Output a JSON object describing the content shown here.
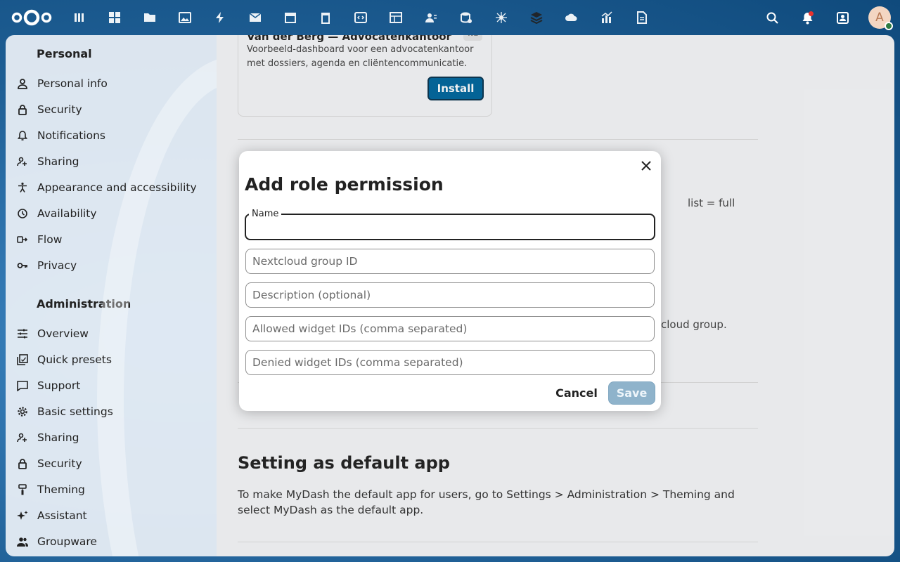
{
  "header": {
    "apps": [
      "dashboard-icon",
      "grid-icon",
      "folder-icon",
      "image-icon",
      "activity-icon",
      "mail-icon",
      "calendar-icon",
      "trash-icon",
      "code-icon",
      "table-icon",
      "contacts-icon",
      "database-icon",
      "spider-icon",
      "layers-icon",
      "cloud-icon",
      "chart-icon",
      "document-icon"
    ],
    "avatar_initial": "A"
  },
  "sidebar": {
    "personal_title": "Personal",
    "personal_items": [
      {
        "label": "Personal info",
        "icon": "user-icon"
      },
      {
        "label": "Security",
        "icon": "lock-icon"
      },
      {
        "label": "Notifications",
        "icon": "bell-icon"
      },
      {
        "label": "Sharing",
        "icon": "share-icon"
      },
      {
        "label": "Appearance and accessibility",
        "icon": "accessibility-icon"
      },
      {
        "label": "Availability",
        "icon": "clock-icon"
      },
      {
        "label": "Flow",
        "icon": "flow-icon"
      },
      {
        "label": "Privacy",
        "icon": "key-icon"
      }
    ],
    "admin_title": "Administration",
    "admin_items": [
      {
        "label": "Overview",
        "icon": "sliders-icon"
      },
      {
        "label": "Quick presets",
        "icon": "presets-icon"
      },
      {
        "label": "Support",
        "icon": "support-icon"
      },
      {
        "label": "Basic settings",
        "icon": "gear-icon"
      },
      {
        "label": "Sharing",
        "icon": "share-icon"
      },
      {
        "label": "Security",
        "icon": "lock-icon"
      },
      {
        "label": "Theming",
        "icon": "brush-icon"
      },
      {
        "label": "Assistant",
        "icon": "sparkle-icon"
      },
      {
        "label": "Groupware",
        "icon": "group-icon"
      }
    ]
  },
  "main": {
    "card": {
      "title": "Van der Berg — Advocatenkantoor",
      "badge": "NL",
      "description": "Voorbeeld-dashboard voor een advocatenkantoor met dossiers, agenda en cliëntencommunicatie.",
      "install_label": "Install"
    },
    "bg_text_1": "list = full",
    "bg_text_2": "cloud group.",
    "section_title": "Setting as default app",
    "section_desc": "To make MyDash the default app for users, go to Settings > Administration > Theming and select MyDash as the default app."
  },
  "modal": {
    "title": "Add role permission",
    "name_label": "Name",
    "name_value": "",
    "group_placeholder": "Nextcloud group ID",
    "description_placeholder": "Description (optional)",
    "allowed_placeholder": "Allowed widget IDs (comma separated)",
    "denied_placeholder": "Denied widget IDs (comma separated)",
    "cancel_label": "Cancel",
    "save_label": "Save"
  }
}
